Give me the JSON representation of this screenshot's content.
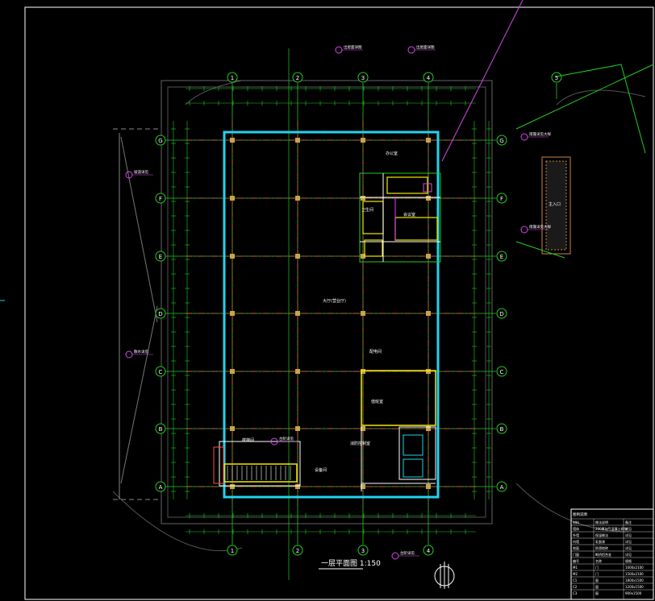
{
  "drawing": {
    "title": "一层平面图 1:150",
    "background": "#000000",
    "colors": {
      "wall": "#22d3ee",
      "grid": "#22cc22",
      "column": "#c8a44a",
      "axis_dash": "#ff4d4d",
      "magenta": "#d946ef",
      "yellow": "#f5e900",
      "white": "#ffffff",
      "hatch": "#cc8844"
    },
    "axes_vertical": [
      "1",
      "2",
      "3",
      "4",
      "5"
    ],
    "axes_horizontal": [
      "G",
      "F",
      "E",
      "D",
      "C",
      "B",
      "A"
    ],
    "room_labels": {
      "main_hall": "大厅(营业厅)",
      "office_top": "办公室",
      "office_top_2": "会议室",
      "toilet": "卫生间",
      "room_mid_right": "配电间",
      "room_lower_right": "值班室",
      "room_lower_right_2": "消防控制室",
      "stair_label": "楼梯间",
      "equipment_room": "设备间",
      "side_note": "主入口"
    },
    "callouts": [
      "出屋面详图",
      "出屋面详图",
      "雨篷详见大样",
      "雨篷详见大样",
      "坡道详见",
      "散水详见",
      "台阶详见",
      "台阶详见"
    ],
    "legend": {
      "header": "图例说明",
      "rows": [
        [
          "材料",
          "做法说明",
          "备注"
        ],
        [
          "墙体",
          "200厚加气混凝土砌块",
          "详见"
        ],
        [
          "外墙",
          "保温做法",
          "详见"
        ],
        [
          "内墙",
          "乳胶漆",
          "详见"
        ],
        [
          "地面",
          "防滑地砖",
          "详见"
        ],
        [
          "门窗",
          "断桥铝合金",
          "详见"
        ]
      ],
      "rows2": [
        [
          "编号",
          "名称",
          "规格"
        ],
        [
          "M1",
          "门",
          "1000x2100"
        ],
        [
          "M2",
          "门",
          "1500x2100"
        ],
        [
          "C1",
          "窗",
          "1800x1500"
        ],
        [
          "C2",
          "窗",
          "1200x1500"
        ],
        [
          "C3",
          "窗",
          "900x1500"
        ]
      ]
    }
  }
}
